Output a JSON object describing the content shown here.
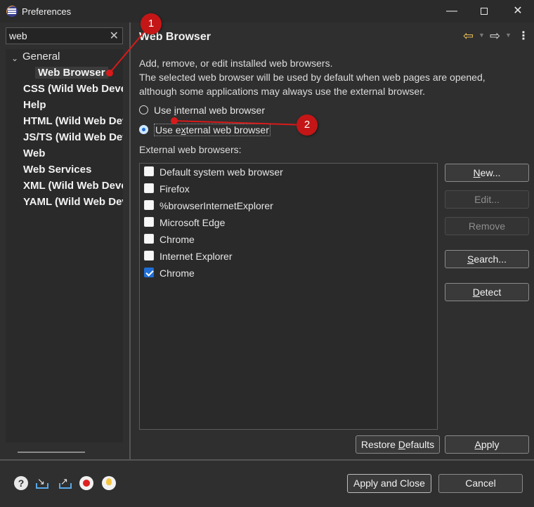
{
  "window": {
    "title": "Preferences",
    "controls": {
      "minimize": "—",
      "close": "✕"
    }
  },
  "filter": {
    "value": "web",
    "clear": "✕"
  },
  "tree": {
    "items": [
      {
        "label": "General",
        "expanded": true,
        "bold": false
      },
      {
        "label": "Web Browser",
        "bold": true,
        "selected": true
      },
      {
        "label": "CSS (Wild Web Developer)",
        "bold": true
      },
      {
        "label": "Help",
        "bold": true
      },
      {
        "label": "HTML (Wild Web Developer)",
        "bold": true
      },
      {
        "label": "JS/TS (Wild Web Developer)",
        "bold": true
      },
      {
        "label": "Web",
        "bold": true
      },
      {
        "label": "Web Services",
        "bold": true
      },
      {
        "label": "XML (Wild Web Developer)",
        "bold": true
      },
      {
        "label": "YAML (Wild Web Developer)",
        "bold": true
      }
    ],
    "expand_glyph": "⌄"
  },
  "page": {
    "title": "Web Browser",
    "nav": {
      "back": "⇦",
      "forward": "⇨",
      "dropdown": "▼",
      "menu": "⋮"
    },
    "description": [
      "Add, remove, or edit installed web browsers.",
      "The selected web browser will be used by default when web pages are opened,",
      "although some applications may always use the external browser."
    ],
    "radios": [
      {
        "pre": "Use ",
        "mnem": "i",
        "post": "nternal web browser",
        "selected": false
      },
      {
        "pre": "Use e",
        "mnem": "x",
        "post": "ternal web browser",
        "selected": true
      }
    ],
    "external_label": "External web browsers:",
    "browsers": [
      {
        "label": "Default system web browser",
        "checked": false
      },
      {
        "label": "Firefox",
        "checked": false
      },
      {
        "label": "%browserInternetExplorer",
        "checked": false
      },
      {
        "label": "Microsoft Edge",
        "checked": false
      },
      {
        "label": "Chrome",
        "checked": false
      },
      {
        "label": "Internet Explorer",
        "checked": false
      },
      {
        "label": "Chrome",
        "checked": true
      }
    ],
    "buttons": {
      "new": {
        "mnem": "N",
        "post": "ew..."
      },
      "edit": "Edit...",
      "remove": "Remove",
      "search": {
        "mnem": "S",
        "post": "earch..."
      },
      "detect": {
        "mnem": "D",
        "post": "etect"
      },
      "restore": {
        "pre": "Restore ",
        "mnem": "D",
        "post": "efaults"
      },
      "apply": {
        "mnem": "A",
        "post": "pply"
      }
    }
  },
  "footer": {
    "help_glyph": "?",
    "apply_close": "Apply and Close",
    "cancel": "Cancel"
  },
  "annotations": [
    {
      "number": "1",
      "color": "#c41616"
    },
    {
      "number": "2",
      "color": "#c41616"
    }
  ]
}
